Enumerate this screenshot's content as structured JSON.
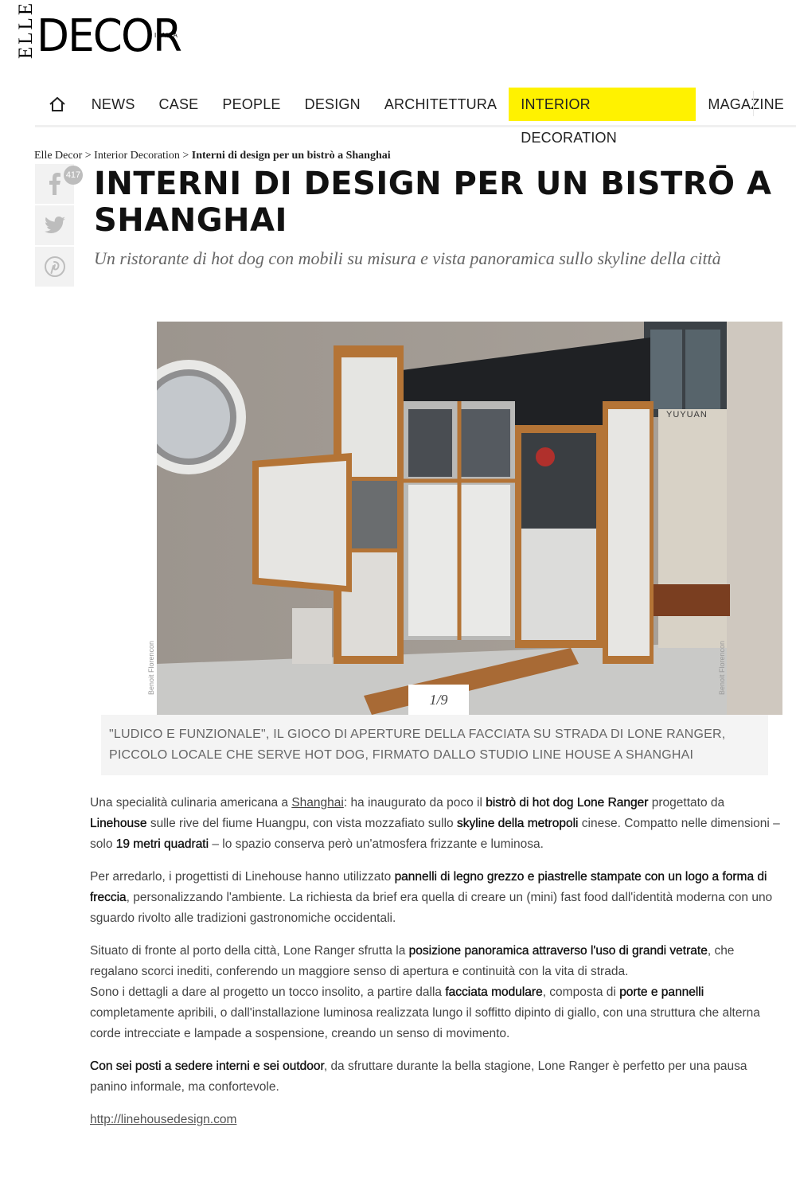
{
  "logo": {
    "elle": "ELLE",
    "decor": "DECOR",
    "italia": "ITALIA"
  },
  "nav": {
    "home_icon": "home-icon",
    "items": [
      "NEWS",
      "CASE",
      "PEOPLE",
      "DESIGN",
      "ARCHITETTURA",
      "INTERIOR DECORATION",
      "MAGAZINE"
    ],
    "active_index": 5,
    "active_color": "#fff200"
  },
  "breadcrumb": {
    "home": "Elle Decor",
    "section": "Interior Decoration",
    "current": "Interni di design per un bistrò a Shanghai",
    "sep": ">"
  },
  "share": {
    "facebook_count": "417",
    "icons": [
      "facebook-icon",
      "twitter-icon",
      "pinterest-icon"
    ]
  },
  "article": {
    "title": "INTERNI DI DESIGN PER UN BISTRŌ A SHANGHAI",
    "subtitle": "Un ristorante di hot dog con mobili su misura e vista panoramica sullo skyline della città"
  },
  "gallery": {
    "credit": "Benoit Florencon",
    "counter": "1/9",
    "caption": "\"LUDICO E FUNZIONALE\", IL GIOCO DI APERTURE DELLA FACCIATA SU STRADA DI LONE RANGER, PICCOLO LOCALE CHE SERVE HOT DOG, FIRMATO DALLO STUDIO LINE HOUSE A SHANGHAI",
    "sign_text": "YUYUAN"
  },
  "body": {
    "p1": {
      "a": "Una specialità culinaria americana a ",
      "link": "Shanghai",
      "b": ": ha inaugurato da poco il ",
      "s1": "bistrò di hot dog Lone Ranger",
      "c": " progettato da ",
      "s2": "Linehouse",
      "d": " sulle rive del fiume Huangpu, con vista mozzafiato sullo ",
      "s3": "skyline della metropoli",
      "e": " cinese. Compatto nelle dimensioni – solo ",
      "s4": "19 metri quadrati",
      "f": " – lo spazio conserva però un'atmosfera frizzante e luminosa."
    },
    "p2": {
      "a": "Per arredarlo, i progettisti di Linehouse hanno utilizzato ",
      "s1": "pannelli di legno grezzo e piastrelle stampate con un logo a forma di freccia",
      "b": ", personalizzando l'ambiente. La richiesta da brief era quella di creare un (mini) fast food dall'identità moderna con uno sguardo rivolto alle tradizioni gastronomiche occidentali."
    },
    "p3": {
      "a": "Situato di fronte al porto della città, Lone Ranger sfrutta la ",
      "s1": "posizione panoramica attraverso l'uso di grandi vetrate",
      "b": ", che regalano scorci inediti, conferendo un maggiore senso di apertura e continuità con la vita di strada.",
      "c": "Sono i dettagli a dare al progetto un tocco insolito, a partire dalla ",
      "s2": "facciata modulare",
      "d": ", composta di ",
      "s3": "porte e pannelli",
      "e": " completamente apribili, o dall'installazione luminosa realizzata lungo il soffitto dipinto di giallo, con una struttura che alterna corde intrecciate e lampade a sospensione, creando un senso di movimento."
    },
    "p4": {
      "s1": "Con sei posti a sedere interni e sei outdoor",
      "a": ", da sfruttare durante la bella stagione, Lone Ranger è perfetto per una pausa panino informale, ma confortevole."
    },
    "url": "http://linehousedesign.com"
  }
}
